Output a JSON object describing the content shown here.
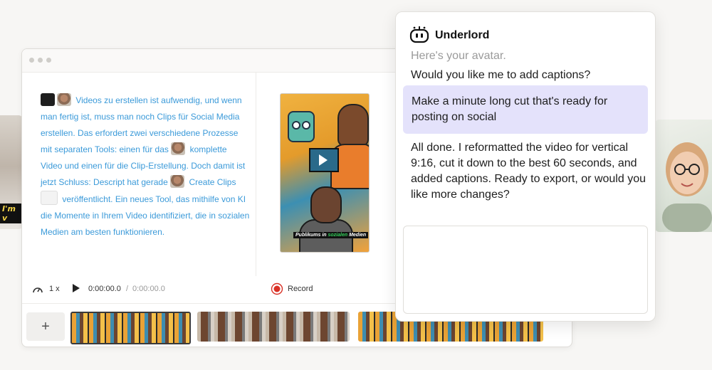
{
  "left_thumb": {
    "caption": "I'm v"
  },
  "editor": {
    "script_text": [
      "Videos zu erstellen ist aufwendig, und wenn man fertig ist, muss man noch Clips für Social Media erstellen. Das erfordert zwei verschiedene Prozesse mit separaten Tools: einen für das",
      "komplette Video und einen für die Clip-Erstellung. Doch damit ist jetzt Schluss: Descript hat gerade",
      "Create Clips",
      "veröffentlicht. Ein neues Tool, das mithilfe von KI die Momente in Ihrem Video identifiziert, die in sozialen Medien am besten funktionieren."
    ],
    "preview_caption_before": "Publikums in ",
    "preview_caption_highlight": "sozialen",
    "preview_caption_after": " Medien",
    "controls": {
      "speed": "1 x",
      "time_current": "0:00:00.0",
      "time_separator": "/",
      "time_total": "0:00:00.0",
      "record_label": "Record"
    },
    "add_label": "+"
  },
  "chat": {
    "title": "Underlord",
    "faded_message": "Here's your avatar.",
    "bot_question": "Would you like me to add captions?",
    "user_message": "Make a minute long cut that's ready for posting on social",
    "bot_reply": "All done. I reformatted the video for vertical 9:16, cut it down to the best 60 seconds, and added captions. Ready to export, or would you like more changes?",
    "input_value": "",
    "colors": {
      "user_bubble": "#e4e2fb",
      "send_button": "#5d5ce6"
    }
  }
}
